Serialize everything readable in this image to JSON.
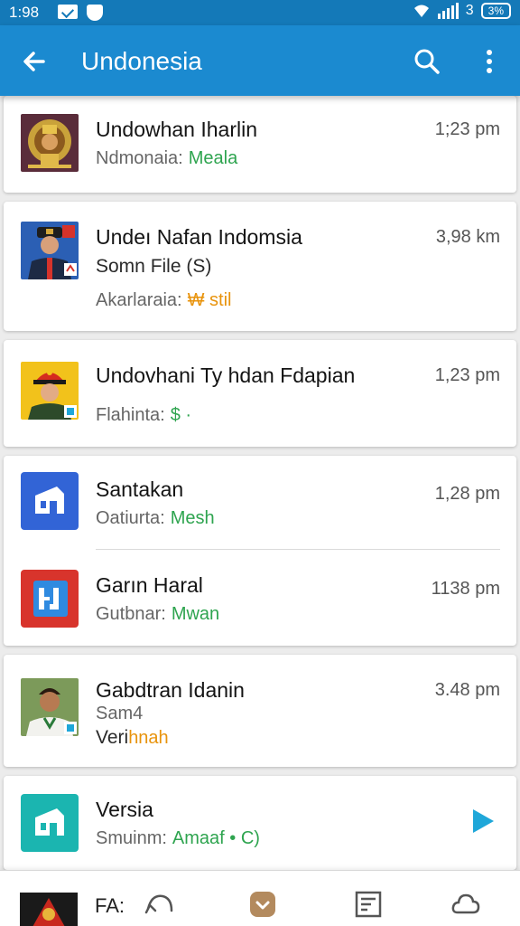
{
  "status_bar": {
    "time": "1:98",
    "network": "3",
    "battery": "3%",
    "icons": [
      "mail-icon",
      "shield-icon",
      "wifi-icon",
      "signal-icon",
      "battery-icon"
    ]
  },
  "app_bar": {
    "title": "Undonesia",
    "icons": [
      "back-arrow-icon",
      "search-icon",
      "more-vert-icon"
    ]
  },
  "colors": {
    "status_bar": "#1479b8",
    "app_bar": "#1b8ad0",
    "green_accent": "#2ea44f",
    "orange_accent": "#e8930c",
    "play_accent": "#1fa7d9"
  },
  "messages": [
    {
      "title": "Undowhan Iharlin",
      "sub_label": "Ndmonaia:",
      "sub_accent": "Meala",
      "time": "1;23 pm",
      "avatar": "ornate-emblem"
    },
    {
      "title": "Undeı Nafan Indomsia",
      "second_line": "Somn File (S)",
      "sub_label": "Akarlaraia:",
      "sub_accent": "₩ stil",
      "time": "3,98 km",
      "avatar": "officer-portrait"
    },
    {
      "title": "Undovhani Ty hdan Fdapian",
      "sub_label": "Flahinta:",
      "sub_accent": "$ ·",
      "time": "1,23 pm",
      "avatar": "red-cap-portrait"
    },
    {
      "title": "Santakan",
      "sub_label": "Oatiurta:",
      "sub_accent": "Mesh",
      "time": "1,28 pm",
      "avatar": "blue-app-icon"
    },
    {
      "title": "Garın Haral",
      "sub_label": "Gutbnar:",
      "sub_accent": "Mwan",
      "time": "1138 pm",
      "avatar": "red-app-icon"
    },
    {
      "title": "Gabdtran Idanin",
      "second_line": "Sam4",
      "sub_label": "Veri",
      "sub_accent": "hnah",
      "time": "3.48 pm",
      "avatar": "man-portrait"
    },
    {
      "title": "Versia",
      "sub_label": "Smuinm:",
      "sub_accent": "Amaaf • C)",
      "avatar": "teal-app-icon",
      "action_icon": "play-icon"
    }
  ],
  "bottom_bar": {
    "label": "FA:",
    "icons": [
      "emblem-avatar",
      "reply-icon",
      "inbox-icon",
      "document-icon",
      "cloud-icon"
    ]
  }
}
